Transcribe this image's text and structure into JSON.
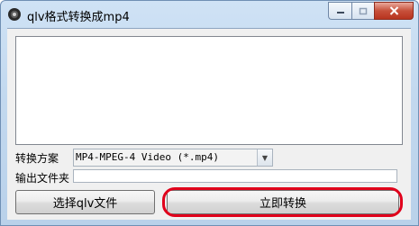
{
  "window": {
    "title": "qlv格式转换成mp4",
    "app_icon": "app-logo-icon",
    "caption_buttons": [
      "minimize-icon",
      "maximize-icon",
      "close-icon"
    ]
  },
  "log": {
    "text": ""
  },
  "form": {
    "format_label": "转换方案",
    "format_value": "MP4-MPEG-4 Video (*.mp4)",
    "folder_label": "输出文件夹",
    "folder_value": ""
  },
  "buttons": {
    "select_label": "选择qlv文件",
    "convert_label": "立即转换"
  },
  "colors": {
    "highlight": "#e0001b",
    "titlebar": "#c3d9ef",
    "close_button": "#c7503a"
  }
}
